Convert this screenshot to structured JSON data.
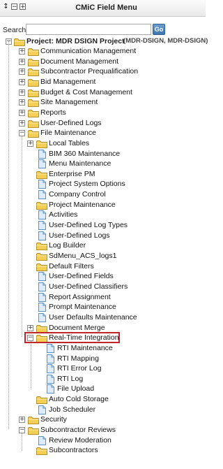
{
  "header": {
    "title": "CMiC Field Menu",
    "icon1": "↕",
    "icon2": "−",
    "icon3": "+"
  },
  "search": {
    "label": "Search",
    "value": "",
    "placeholder": "",
    "go_label": "Go"
  },
  "tree": {
    "root": {
      "label": "Project: MDR DSIGN Project",
      "code": "(MDR-DSIGN, MDR-DSIGN)"
    },
    "items": [
      {
        "label": "Communication Management"
      },
      {
        "label": "Document Management"
      },
      {
        "label": "Subcontractor Prequalification"
      },
      {
        "label": "Bid Management"
      },
      {
        "label": "Budget & Cost Management"
      },
      {
        "label": "Site Management"
      },
      {
        "label": "Reports"
      },
      {
        "label": "User-Defined Logs"
      },
      {
        "label": "File Maintenance"
      },
      {
        "label": "Local Tables"
      },
      {
        "label": "BIM 360 Maintenance"
      },
      {
        "label": "Menu Maintenance"
      },
      {
        "label": "Enterprise PM"
      },
      {
        "label": "Project System Options"
      },
      {
        "label": "Company Control"
      },
      {
        "label": "Project Maintenance"
      },
      {
        "label": "Activities"
      },
      {
        "label": "User-Defined Log Types"
      },
      {
        "label": "User-Defined Logs"
      },
      {
        "label": "Log Builder"
      },
      {
        "label": "SdMenu_ACS_logs1"
      },
      {
        "label": "Default Filters"
      },
      {
        "label": "User-Defined Fields"
      },
      {
        "label": "User-Defined Classifiers"
      },
      {
        "label": "Report Assignment"
      },
      {
        "label": "Prompt Maintenance"
      },
      {
        "label": "User Defaults Maintenance"
      },
      {
        "label": "Document Merge"
      },
      {
        "label": "Real-Time Integration"
      },
      {
        "label": "RTI Maintenance"
      },
      {
        "label": "RTI Mapping"
      },
      {
        "label": "RTI Error Log"
      },
      {
        "label": "RTI Log"
      },
      {
        "label": "File Upload"
      },
      {
        "label": "Auto Cold Storage"
      },
      {
        "label": "Job Scheduler"
      },
      {
        "label": "Security"
      },
      {
        "label": "Subcontractor Reviews"
      },
      {
        "label": "Review Moderation"
      },
      {
        "label": "Subcontractors"
      }
    ]
  },
  "colors": {
    "highlight_border": "#c0242c",
    "go_button": "#3f74ad",
    "folder": "#f2c94c"
  }
}
